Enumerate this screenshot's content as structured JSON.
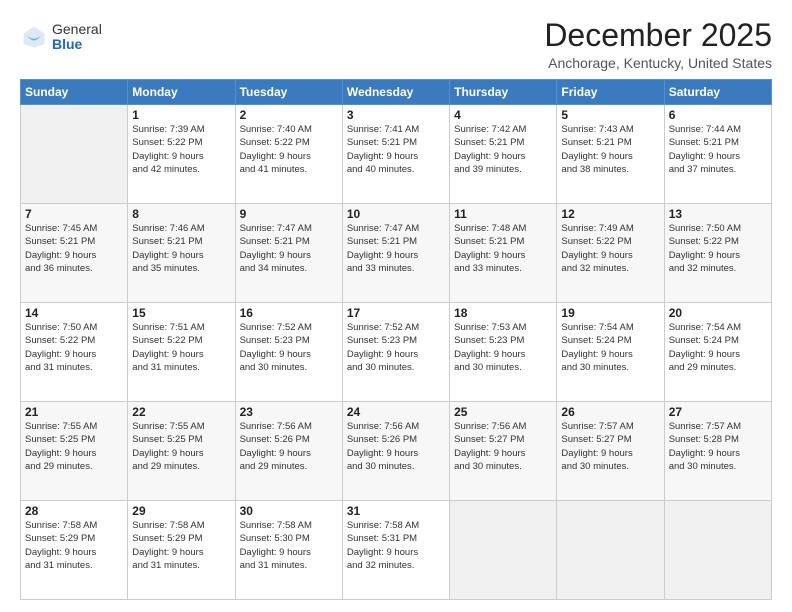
{
  "logo": {
    "general": "General",
    "blue": "Blue"
  },
  "header": {
    "title": "December 2025",
    "subtitle": "Anchorage, Kentucky, United States"
  },
  "days_of_week": [
    "Sunday",
    "Monday",
    "Tuesday",
    "Wednesday",
    "Thursday",
    "Friday",
    "Saturday"
  ],
  "weeks": [
    [
      {
        "day": "",
        "info": ""
      },
      {
        "day": "1",
        "info": "Sunrise: 7:39 AM\nSunset: 5:22 PM\nDaylight: 9 hours\nand 42 minutes."
      },
      {
        "day": "2",
        "info": "Sunrise: 7:40 AM\nSunset: 5:22 PM\nDaylight: 9 hours\nand 41 minutes."
      },
      {
        "day": "3",
        "info": "Sunrise: 7:41 AM\nSunset: 5:21 PM\nDaylight: 9 hours\nand 40 minutes."
      },
      {
        "day": "4",
        "info": "Sunrise: 7:42 AM\nSunset: 5:21 PM\nDaylight: 9 hours\nand 39 minutes."
      },
      {
        "day": "5",
        "info": "Sunrise: 7:43 AM\nSunset: 5:21 PM\nDaylight: 9 hours\nand 38 minutes."
      },
      {
        "day": "6",
        "info": "Sunrise: 7:44 AM\nSunset: 5:21 PM\nDaylight: 9 hours\nand 37 minutes."
      }
    ],
    [
      {
        "day": "7",
        "info": "Sunrise: 7:45 AM\nSunset: 5:21 PM\nDaylight: 9 hours\nand 36 minutes."
      },
      {
        "day": "8",
        "info": "Sunrise: 7:46 AM\nSunset: 5:21 PM\nDaylight: 9 hours\nand 35 minutes."
      },
      {
        "day": "9",
        "info": "Sunrise: 7:47 AM\nSunset: 5:21 PM\nDaylight: 9 hours\nand 34 minutes."
      },
      {
        "day": "10",
        "info": "Sunrise: 7:47 AM\nSunset: 5:21 PM\nDaylight: 9 hours\nand 33 minutes."
      },
      {
        "day": "11",
        "info": "Sunrise: 7:48 AM\nSunset: 5:21 PM\nDaylight: 9 hours\nand 33 minutes."
      },
      {
        "day": "12",
        "info": "Sunrise: 7:49 AM\nSunset: 5:22 PM\nDaylight: 9 hours\nand 32 minutes."
      },
      {
        "day": "13",
        "info": "Sunrise: 7:50 AM\nSunset: 5:22 PM\nDaylight: 9 hours\nand 32 minutes."
      }
    ],
    [
      {
        "day": "14",
        "info": "Sunrise: 7:50 AM\nSunset: 5:22 PM\nDaylight: 9 hours\nand 31 minutes."
      },
      {
        "day": "15",
        "info": "Sunrise: 7:51 AM\nSunset: 5:22 PM\nDaylight: 9 hours\nand 31 minutes."
      },
      {
        "day": "16",
        "info": "Sunrise: 7:52 AM\nSunset: 5:23 PM\nDaylight: 9 hours\nand 30 minutes."
      },
      {
        "day": "17",
        "info": "Sunrise: 7:52 AM\nSunset: 5:23 PM\nDaylight: 9 hours\nand 30 minutes."
      },
      {
        "day": "18",
        "info": "Sunrise: 7:53 AM\nSunset: 5:23 PM\nDaylight: 9 hours\nand 30 minutes."
      },
      {
        "day": "19",
        "info": "Sunrise: 7:54 AM\nSunset: 5:24 PM\nDaylight: 9 hours\nand 30 minutes."
      },
      {
        "day": "20",
        "info": "Sunrise: 7:54 AM\nSunset: 5:24 PM\nDaylight: 9 hours\nand 29 minutes."
      }
    ],
    [
      {
        "day": "21",
        "info": "Sunrise: 7:55 AM\nSunset: 5:25 PM\nDaylight: 9 hours\nand 29 minutes."
      },
      {
        "day": "22",
        "info": "Sunrise: 7:55 AM\nSunset: 5:25 PM\nDaylight: 9 hours\nand 29 minutes."
      },
      {
        "day": "23",
        "info": "Sunrise: 7:56 AM\nSunset: 5:26 PM\nDaylight: 9 hours\nand 29 minutes."
      },
      {
        "day": "24",
        "info": "Sunrise: 7:56 AM\nSunset: 5:26 PM\nDaylight: 9 hours\nand 30 minutes."
      },
      {
        "day": "25",
        "info": "Sunrise: 7:56 AM\nSunset: 5:27 PM\nDaylight: 9 hours\nand 30 minutes."
      },
      {
        "day": "26",
        "info": "Sunrise: 7:57 AM\nSunset: 5:27 PM\nDaylight: 9 hours\nand 30 minutes."
      },
      {
        "day": "27",
        "info": "Sunrise: 7:57 AM\nSunset: 5:28 PM\nDaylight: 9 hours\nand 30 minutes."
      }
    ],
    [
      {
        "day": "28",
        "info": "Sunrise: 7:58 AM\nSunset: 5:29 PM\nDaylight: 9 hours\nand 31 minutes."
      },
      {
        "day": "29",
        "info": "Sunrise: 7:58 AM\nSunset: 5:29 PM\nDaylight: 9 hours\nand 31 minutes."
      },
      {
        "day": "30",
        "info": "Sunrise: 7:58 AM\nSunset: 5:30 PM\nDaylight: 9 hours\nand 31 minutes."
      },
      {
        "day": "31",
        "info": "Sunrise: 7:58 AM\nSunset: 5:31 PM\nDaylight: 9 hours\nand 32 minutes."
      },
      {
        "day": "",
        "info": ""
      },
      {
        "day": "",
        "info": ""
      },
      {
        "day": "",
        "info": ""
      }
    ]
  ]
}
